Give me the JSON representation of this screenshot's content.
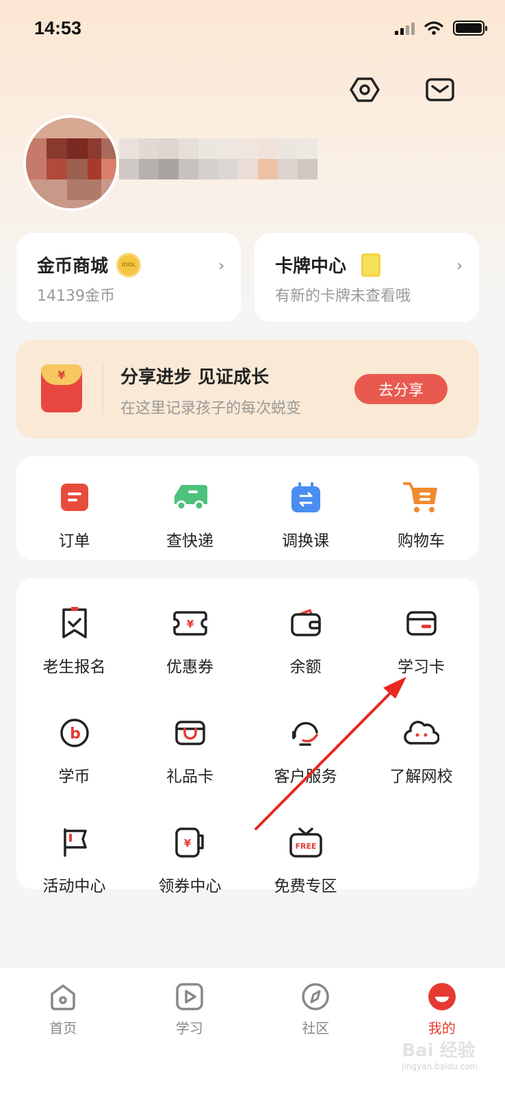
{
  "status_bar": {
    "time": "14:53"
  },
  "coin_mall": {
    "title": "金币商城",
    "subtitle": "14139金币",
    "badge": "IDOL"
  },
  "card_center": {
    "title": "卡牌中心",
    "subtitle": "有新的卡牌未查看哦"
  },
  "share": {
    "title": "分享进步 见证成长",
    "subtitle": "在这里记录孩子的每次蜕变",
    "button": "去分享",
    "icon_glyph": "¥"
  },
  "quick_actions": [
    {
      "label": "订单",
      "icon": "order-icon",
      "color": "#e74c3c"
    },
    {
      "label": "查快递",
      "icon": "delivery-truck-icon",
      "color": "#4cc27a"
    },
    {
      "label": "调换课",
      "icon": "calendar-swap-icon",
      "color": "#4a8df0"
    },
    {
      "label": "购物车",
      "icon": "shopping-cart-icon",
      "color": "#f08b2f"
    }
  ],
  "services": [
    {
      "label": "老生报名",
      "icon": "bookmark-check-icon"
    },
    {
      "label": "优惠券",
      "icon": "coupon-icon"
    },
    {
      "label": "余额",
      "icon": "wallet-icon"
    },
    {
      "label": "学习卡",
      "icon": "card-icon"
    },
    {
      "label": "学币",
      "icon": "coin-b-icon"
    },
    {
      "label": "礼品卡",
      "icon": "gift-card-icon"
    },
    {
      "label": "客户服务",
      "icon": "headset-icon"
    },
    {
      "label": "了解网校",
      "icon": "cloud-face-icon"
    },
    {
      "label": "活动中心",
      "icon": "flag-icon"
    },
    {
      "label": "领券中心",
      "icon": "coupon-mug-icon"
    },
    {
      "label": "免费专区",
      "icon": "free-tv-icon"
    }
  ],
  "service_glyphs": {
    "yen": "¥",
    "coin": "b",
    "free": "FREE"
  },
  "tabs": [
    {
      "label": "首页",
      "icon": "home-icon"
    },
    {
      "label": "学习",
      "icon": "play-icon"
    },
    {
      "label": "社区",
      "icon": "compass-icon"
    },
    {
      "label": "我的",
      "icon": "profile-icon",
      "active": true
    }
  ],
  "watermark": {
    "text": "Bai 经验",
    "sub": "jingyan.baidu.com"
  },
  "colors": {
    "accent": "#e53a32",
    "share_button": "#e85a4f",
    "banner_bg": "#f9e9d5",
    "annotation_arrow": "#e8281e"
  }
}
